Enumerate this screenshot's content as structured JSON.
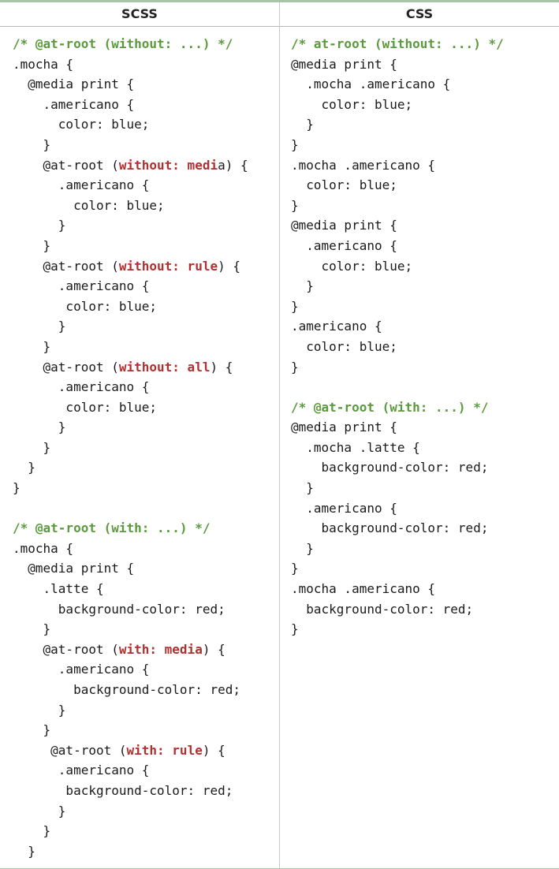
{
  "headers": {
    "scss": "SCSS",
    "css": "CSS"
  },
  "colors": {
    "comment": "#5a9a3c",
    "keyword": "#b03030",
    "rule": "#a8c4a8"
  },
  "scss_lines": [
    [
      {
        "t": "/* @at-root (without: ...) */",
        "c": "cmt"
      }
    ],
    [
      {
        "t": ".mocha {"
      }
    ],
    [
      {
        "t": "  @media print {"
      }
    ],
    [
      {
        "t": "    .americano {"
      }
    ],
    [
      {
        "t": "      color: blue;"
      }
    ],
    [
      {
        "t": "    }"
      }
    ],
    [
      {
        "t": "    @at-root ("
      },
      {
        "t": "without: medi",
        "c": "kw"
      },
      {
        "t": "a) {"
      }
    ],
    [
      {
        "t": "      .americano {"
      }
    ],
    [
      {
        "t": "        color: blue;"
      }
    ],
    [
      {
        "t": "      }"
      }
    ],
    [
      {
        "t": "    }"
      }
    ],
    [
      {
        "t": "    @at-root ("
      },
      {
        "t": "without: rule",
        "c": "kw"
      },
      {
        "t": ") {"
      }
    ],
    [
      {
        "t": "      .americano {"
      }
    ],
    [
      {
        "t": "       color: blue;"
      }
    ],
    [
      {
        "t": "      }"
      }
    ],
    [
      {
        "t": "    }"
      }
    ],
    [
      {
        "t": "    @at-root ("
      },
      {
        "t": "without: all",
        "c": "kw"
      },
      {
        "t": ") {"
      }
    ],
    [
      {
        "t": "      .americano {"
      }
    ],
    [
      {
        "t": "       color: blue;"
      }
    ],
    [
      {
        "t": "      }"
      }
    ],
    [
      {
        "t": "    }"
      }
    ],
    [
      {
        "t": "  }"
      }
    ],
    [
      {
        "t": "}"
      }
    ],
    [
      {
        "t": ""
      }
    ],
    [
      {
        "t": "/* @at-root (with: ...) */",
        "c": "cmt"
      }
    ],
    [
      {
        "t": ".mocha {"
      }
    ],
    [
      {
        "t": "  @media print {"
      }
    ],
    [
      {
        "t": "    .latte {"
      }
    ],
    [
      {
        "t": "      background-color: red;"
      }
    ],
    [
      {
        "t": "    }"
      }
    ],
    [
      {
        "t": "    @at-root ("
      },
      {
        "t": "with: media",
        "c": "kw"
      },
      {
        "t": ") {"
      }
    ],
    [
      {
        "t": "      .americano {"
      }
    ],
    [
      {
        "t": "        background-color: red;"
      }
    ],
    [
      {
        "t": "      }"
      }
    ],
    [
      {
        "t": "    }"
      }
    ],
    [
      {
        "t": "     @at-root ("
      },
      {
        "t": "with: rule",
        "c": "kw"
      },
      {
        "t": ") {"
      }
    ],
    [
      {
        "t": "      .americano {"
      }
    ],
    [
      {
        "t": "       background-color: red;"
      }
    ],
    [
      {
        "t": "      }"
      }
    ],
    [
      {
        "t": "    }"
      }
    ],
    [
      {
        "t": "  }"
      }
    ]
  ],
  "css_lines": [
    [
      {
        "t": "/* at-root (without: ...) */",
        "c": "cmt"
      }
    ],
    [
      {
        "t": "@media print {"
      }
    ],
    [
      {
        "t": "  .mocha .americano {"
      }
    ],
    [
      {
        "t": "    color: blue;"
      }
    ],
    [
      {
        "t": "  }"
      }
    ],
    [
      {
        "t": "}"
      }
    ],
    [
      {
        "t": ".mocha .americano {"
      }
    ],
    [
      {
        "t": "  color: blue;"
      }
    ],
    [
      {
        "t": "}"
      }
    ],
    [
      {
        "t": "@media print {"
      }
    ],
    [
      {
        "t": "  .americano {"
      }
    ],
    [
      {
        "t": "    color: blue;"
      }
    ],
    [
      {
        "t": "  }"
      }
    ],
    [
      {
        "t": "}"
      }
    ],
    [
      {
        "t": ".americano {"
      }
    ],
    [
      {
        "t": "  color: blue;"
      }
    ],
    [
      {
        "t": "}"
      }
    ],
    [
      {
        "t": ""
      }
    ],
    [
      {
        "t": "/* @at-root (with: ...) */",
        "c": "cmt"
      }
    ],
    [
      {
        "t": "@media print {"
      }
    ],
    [
      {
        "t": "  .mocha .latte {"
      }
    ],
    [
      {
        "t": "    background-color: red;"
      }
    ],
    [
      {
        "t": "  }"
      }
    ],
    [
      {
        "t": "  .americano {"
      }
    ],
    [
      {
        "t": "    background-color: red;"
      }
    ],
    [
      {
        "t": "  }"
      }
    ],
    [
      {
        "t": "}"
      }
    ],
    [
      {
        "t": ".mocha .americano {"
      }
    ],
    [
      {
        "t": "  background-color: red;"
      }
    ],
    [
      {
        "t": "}"
      }
    ]
  ]
}
